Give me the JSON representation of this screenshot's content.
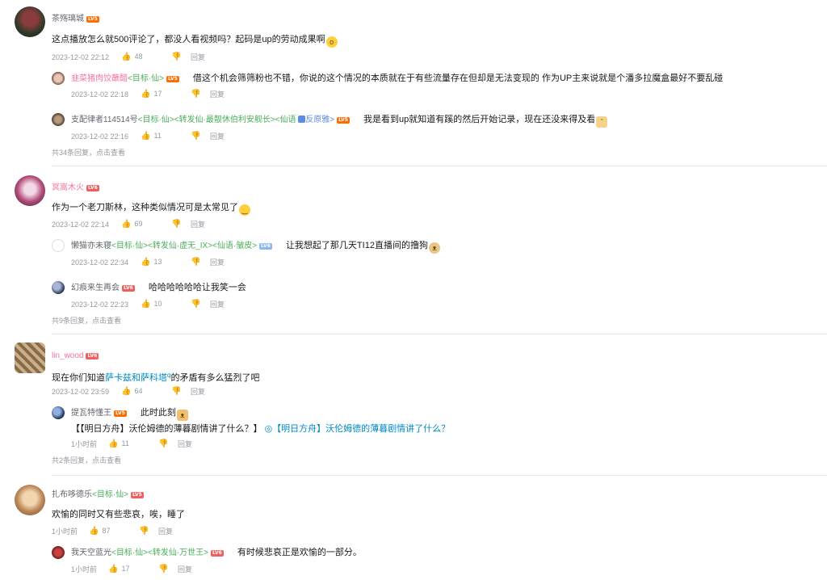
{
  "comments": [
    {
      "user": "茶殇璃城",
      "level": "LV5",
      "text": "这点播放怎么就500评论了，都没人看视频吗？起码是up的劳动成果啊",
      "time": "2023-12-02 22:12",
      "likes": "48",
      "reply_label": "回复",
      "replies": [
        {
          "user": "韭菜猪肉饺蘸醋",
          "tags": "<目标·仙>",
          "level": "LV5",
          "text": "借这个机会筛筛粉也不错，你说的这个情况的本质就在于有些流量存在但却是无法变现的  作为UP主来说就是个潘多拉魔盒最好不要乱碰",
          "time": "2023-12-02 22:18",
          "likes": "17",
          "reply_label": "回复"
        },
        {
          "user": "支配律者114514号",
          "tags": "<目标·仙><转发仙·最靓休伯利安舰长><仙语",
          "tags2": "反原雅>",
          "level": "LV5",
          "text": "我是看到up就知道有蹊的然后开始记录，现在还没来得及看",
          "time": "2023-12-02 22:16",
          "likes": "11",
          "reply_label": "回复"
        }
      ],
      "more": "共34条回复，点击查看"
    },
    {
      "user": "冥嵩木火",
      "level": "LV6",
      "text": "作为一个老刀斯林，这种类似情况可是太常见了",
      "time": "2023-12-02 22:14",
      "likes": "69",
      "reply_label": "回复",
      "replies": [
        {
          "user": "懒猫亦未寝",
          "tags": "<目标·仙><转发仙·虚无_IX><仙语·皱皮>",
          "level": "LV6",
          "text": "让我想起了那几天TI12直播间的撸狗",
          "time": "2023-12-02 22:34",
          "likes": "13",
          "reply_label": "回复"
        },
        {
          "user": "幻痕来生再会",
          "tags": "",
          "level": "LV6",
          "text": "哈哈哈哈哈哈让我笑一会",
          "time": "2023-12-02 22:23",
          "likes": "10",
          "reply_label": "回复"
        }
      ],
      "more": "共9条回复，点击查看"
    },
    {
      "user": "lin_wood",
      "level": "LV6",
      "text_prefix": "现在你们知道",
      "text_link": "萨卡兹和萨科塔",
      "text_suffix": "的矛盾有多么猛烈了吧",
      "time": "2023-12-02 23:59",
      "likes": "64",
      "reply_label": "回复",
      "replies": [
        {
          "user": "提瓦特懂王",
          "tags": "",
          "level": "LV5",
          "text": "此时此刻",
          "line2_prefix": "【【明日方舟】沃伦姆德的薄暮剧情讲了什么？】",
          "line2_link": "◎【明日方舟】沃伦姆德的薄暮剧情讲了什么？",
          "time": "1小时前",
          "likes": "11",
          "reply_label": "回复"
        }
      ],
      "more": "共2条回复，点击查看"
    },
    {
      "user": "扎布哆德乐",
      "tags": "<目标·仙>",
      "level": "LV5",
      "text": "欢愉的同时又有些悲哀，唉，睡了",
      "time": "1小时前",
      "likes": "87",
      "reply_label": "回复",
      "replies": [
        {
          "user": "我天空蓝光",
          "tags": "<目标·仙><转发仙·万世王>",
          "level": "LV6",
          "text": "有时候悲哀正是欢愉的一部分。",
          "time": "1小时前",
          "likes": "17",
          "reply_label": "回复"
        }
      ]
    }
  ],
  "icons": {
    "like": "thumb-up-icon",
    "dislike": "thumb-down-icon"
  },
  "colors": {
    "username_vip": "#fb7299",
    "tag_green": "#4cae5a",
    "link": "#008ac5",
    "meta": "#9499a0"
  }
}
